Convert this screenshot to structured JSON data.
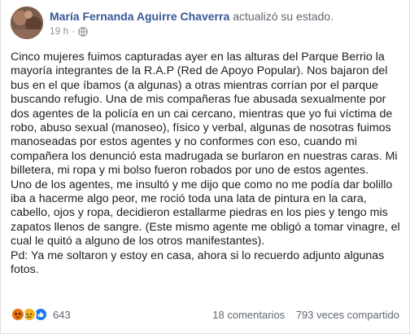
{
  "post": {
    "author": "María Fernanda Aguirre Chaverra",
    "action": "actualizó su estado.",
    "time": "19 h",
    "privacy_icon": "globe-icon",
    "paragraphs": [
      "Cinco mujeres fuimos capturadas ayer en las alturas del Parque Berrio la mayoría integrantes de la R.A.P (Red de Apoyo Popular). Nos bajaron del bus en el que íbamos (a algunas) a otras mientras corrían por el parque buscando refugio. Una de mis compañeras fue abusada sexualmente por dos agentes de la policía en un cai cercano, mientras que yo fui víctima de robo, abuso sexual (manoseo), físico y verbal, algunas de nosotras fuimos manoseadas por estos agentes y no conformes con eso, cuando mi compañera los denunció esta madrugada se burlaron en nuestras caras. Mi billetera, mi ropa y mi bolso fueron robados por uno de estos agentes.",
      "Uno de los agentes, me insultó y me dijo que como no me podía dar bolillo iba a hacerme algo peor, me roció toda una lata de pintura en la cara, cabello, ojos y ropa, decidieron estallarme piedras en los pies y tengo mis zapatos llenos de sangre. (Este mismo agente me obligó a tomar vinagre, el cual le quitó a alguno de los otros manifestantes).",
      "Pd: Ya me soltaron y estoy en casa, ahora si lo recuerdo adjunto algunas fotos."
    ]
  },
  "footer": {
    "reactions": [
      "angry-react-icon",
      "sad-react-icon",
      "like-react-icon"
    ],
    "reaction_count": "643",
    "comments": "18 comentarios",
    "shares": "793 veces compartido"
  },
  "colors": {
    "author": "#385898",
    "like": "#1877f2",
    "angry": "#e9710f",
    "sad": "#f7b125"
  }
}
